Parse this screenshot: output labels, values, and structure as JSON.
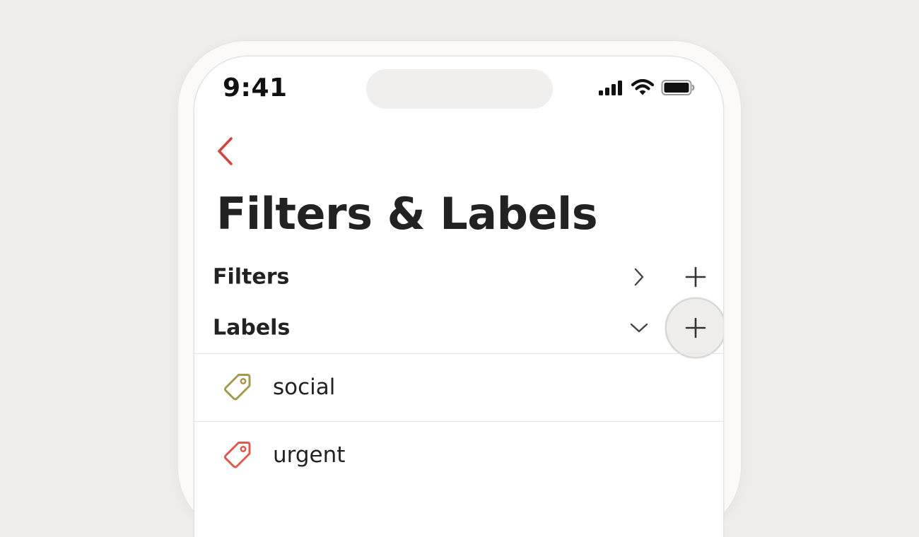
{
  "status_bar": {
    "time": "9:41"
  },
  "nav": {
    "back_icon": "chevron-left-icon",
    "accent_color": "#d1453b"
  },
  "page": {
    "title": "Filters & Labels"
  },
  "sections": {
    "filters": {
      "label": "Filters",
      "expanded": false,
      "chevron_icon": "chevron-right-icon",
      "add_icon": "plus-icon"
    },
    "labels": {
      "label": "Labels",
      "expanded": true,
      "chevron_icon": "chevron-down-icon",
      "add_icon": "plus-icon",
      "add_highlighted": true
    }
  },
  "labels": [
    {
      "name": "social",
      "icon": "tag-icon",
      "color": "#a39a4f"
    },
    {
      "name": "urgent",
      "icon": "tag-icon",
      "color": "#dd5b4d"
    }
  ]
}
